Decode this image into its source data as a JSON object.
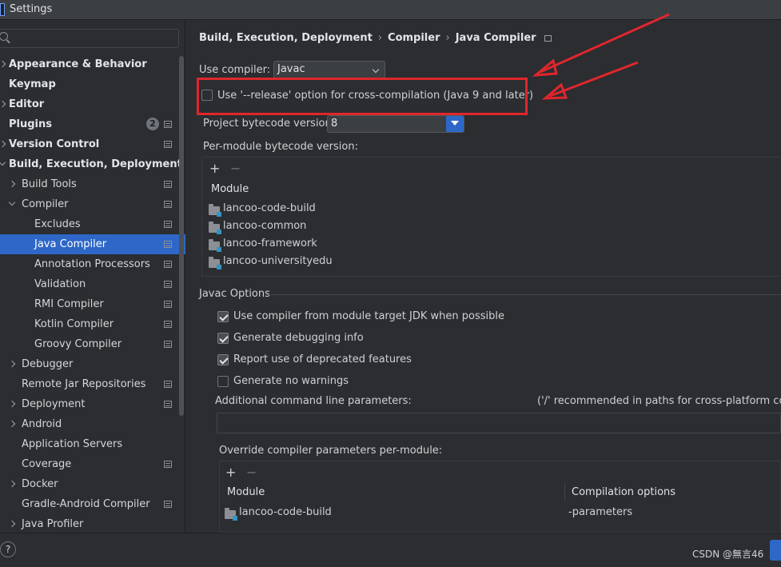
{
  "window": {
    "title": "Settings"
  },
  "sidebar": {
    "items": [
      {
        "label": "Appearance & Behavior",
        "level": 0,
        "bold": true,
        "expander": "right"
      },
      {
        "label": "Keymap",
        "level": 0,
        "bold": true
      },
      {
        "label": "Editor",
        "level": 0,
        "bold": true,
        "expander": "right"
      },
      {
        "label": "Plugins",
        "level": 0,
        "bold": true,
        "badge": "2",
        "gear": true
      },
      {
        "label": "Version Control",
        "level": 0,
        "bold": true,
        "expander": "right",
        "gear": true
      },
      {
        "label": "Build, Execution, Deployment",
        "level": 0,
        "bold": true,
        "expander": "down"
      },
      {
        "label": "Build Tools",
        "level": 1,
        "expander": "right",
        "gear": true
      },
      {
        "label": "Compiler",
        "level": 1,
        "expander": "down",
        "gear": true
      },
      {
        "label": "Excludes",
        "level": 2,
        "gear": true
      },
      {
        "label": "Java Compiler",
        "level": 2,
        "gear": true,
        "selected": true
      },
      {
        "label": "Annotation Processors",
        "level": 2,
        "gear": true
      },
      {
        "label": "Validation",
        "level": 2,
        "gear": true
      },
      {
        "label": "RMI Compiler",
        "level": 2,
        "gear": true
      },
      {
        "label": "Kotlin Compiler",
        "level": 2,
        "gear": true
      },
      {
        "label": "Groovy Compiler",
        "level": 2,
        "gear": true
      },
      {
        "label": "Debugger",
        "level": 1,
        "expander": "right"
      },
      {
        "label": "Remote Jar Repositories",
        "level": 1,
        "gear": true
      },
      {
        "label": "Deployment",
        "level": 1,
        "expander": "right",
        "gear": true
      },
      {
        "label": "Android",
        "level": 1,
        "expander": "right"
      },
      {
        "label": "Application Servers",
        "level": 1
      },
      {
        "label": "Coverage",
        "level": 1,
        "gear": true
      },
      {
        "label": "Docker",
        "level": 1,
        "expander": "right"
      },
      {
        "label": "Gradle-Android Compiler",
        "level": 1,
        "gear": true
      },
      {
        "label": "Java Profiler",
        "level": 1,
        "expander": "right"
      }
    ]
  },
  "breadcrumb": {
    "part1": "Build, Execution, Deployment",
    "part2": "Compiler",
    "part3": "Java Compiler"
  },
  "compiler": {
    "use_compiler_label": "Use compiler:",
    "use_compiler_value": "Javac",
    "release_option_label": "Use '--release' option for cross-compilation (Java 9 and later)",
    "release_option_checked": false,
    "bytecode_label": "Project bytecode version:",
    "bytecode_value": "8",
    "per_module_label": "Per-module bytecode version:",
    "per_module_table": {
      "add": "+",
      "remove": "−",
      "column": "Module",
      "rows": [
        "lancoo-code-build",
        "lancoo-common",
        "lancoo-framework",
        "lancoo-universityedu"
      ]
    }
  },
  "javac": {
    "section_title": "Javac Options",
    "options": [
      {
        "label": "Use compiler from module target JDK when possible",
        "checked": true
      },
      {
        "label": "Generate debugging info",
        "checked": true
      },
      {
        "label": "Report use of deprecated features",
        "checked": true
      },
      {
        "label": "Generate no warnings",
        "checked": false
      }
    ],
    "additional_label": "Additional command line parameters:",
    "additional_hint": "('/' recommended in paths for cross-platform config",
    "override_label": "Override compiler parameters per-module:",
    "override_table": {
      "add": "+",
      "remove": "−",
      "col_module": "Module",
      "col_options": "Compilation options",
      "rows": [
        {
          "module": "lancoo-code-build",
          "options": "-parameters"
        }
      ]
    }
  },
  "footer": {
    "help": "?",
    "watermark": "CSDN @無言46"
  },
  "colors": {
    "accent": "#2e67c7",
    "annotation": "#e0262d"
  }
}
